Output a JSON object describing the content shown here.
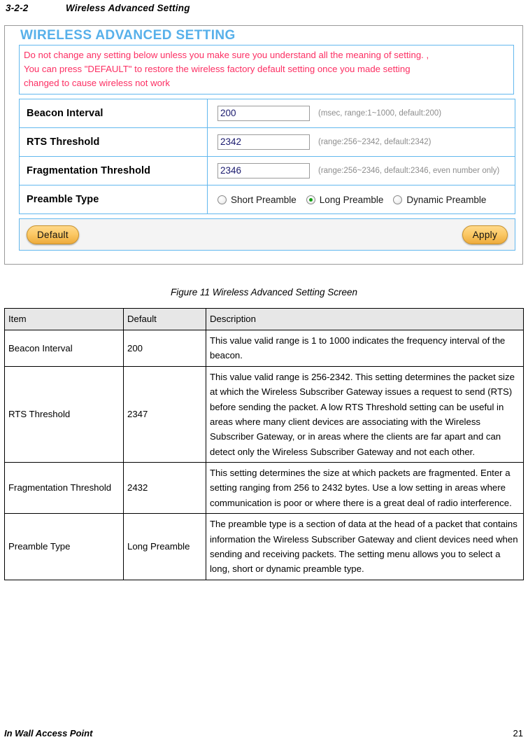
{
  "section": {
    "number": "3-2-2",
    "title": "Wireless Advanced Setting"
  },
  "screenshot": {
    "title": "WIRELESS ADVANCED SETTING",
    "warning": {
      "line1": "Do not change any setting below unless you make sure you understand all the meaning of setting. ,",
      "line2": "You can press \"DEFAULT\" to restore the wireless factory default setting once you made setting",
      "line3": "changed to cause wireless not work"
    },
    "rows": [
      {
        "label": "Beacon Interval",
        "value": "200",
        "hint": "(msec, range:1~1000, default:200)"
      },
      {
        "label": "RTS Threshold",
        "value": "2342",
        "hint": "(range:256~2342, default:2342)"
      },
      {
        "label": "Fragmentation Threshold",
        "value": "2346",
        "hint": "(range:256~2346, default:2346, even number only)"
      }
    ],
    "preamble": {
      "label": "Preamble Type",
      "options": [
        {
          "label": "Short Preamble",
          "selected": false
        },
        {
          "label": "Long Preamble",
          "selected": true
        },
        {
          "label": "Dynamic Preamble",
          "selected": false
        }
      ]
    },
    "buttons": {
      "default_label": "Default",
      "apply_label": "Apply"
    },
    "colors": {
      "title": "#57b0ea",
      "warning_text": "#fc2f63",
      "box_border": "#63b8ee",
      "button_face": "#fbc864",
      "radio_selected": "#12a012"
    }
  },
  "figure_caption": "Figure 11 Wireless Advanced Setting Screen",
  "table": {
    "headers": [
      "Item",
      "Default",
      "Description"
    ],
    "rows": [
      {
        "item": "Beacon Interval",
        "default": "200",
        "description": "This value valid range is 1 to 1000 indicates the frequency interval of the beacon."
      },
      {
        "item": "RTS Threshold",
        "default": "2347",
        "description": "This value valid range is 256-2342. This setting determines the packet size at which the Wireless Subscriber Gateway issues a request to send (RTS) before sending the packet. A low RTS Threshold setting can be useful in areas where many client devices are associating with the Wireless Subscriber Gateway, or in areas where the clients are far apart and can detect only the Wireless Subscriber Gateway and not each other."
      },
      {
        "item": "Fragmentation Threshold",
        "default": "2432",
        "description": "This setting determines the size at which packets are fragmented. Enter a setting ranging from 256 to 2432 bytes. Use a low setting in areas where communication is poor or where there is a great deal of radio interference."
      },
      {
        "item": "Preamble Type",
        "default": "Long Preamble",
        "description": "The preamble type is a section of data at the head of a packet that contains information the Wireless Subscriber Gateway and client devices need when sending and receiving packets. The setting menu allows you to select a long, short or dynamic preamble type."
      }
    ]
  },
  "footer": {
    "left": "In Wall Access Point",
    "page": "21"
  }
}
